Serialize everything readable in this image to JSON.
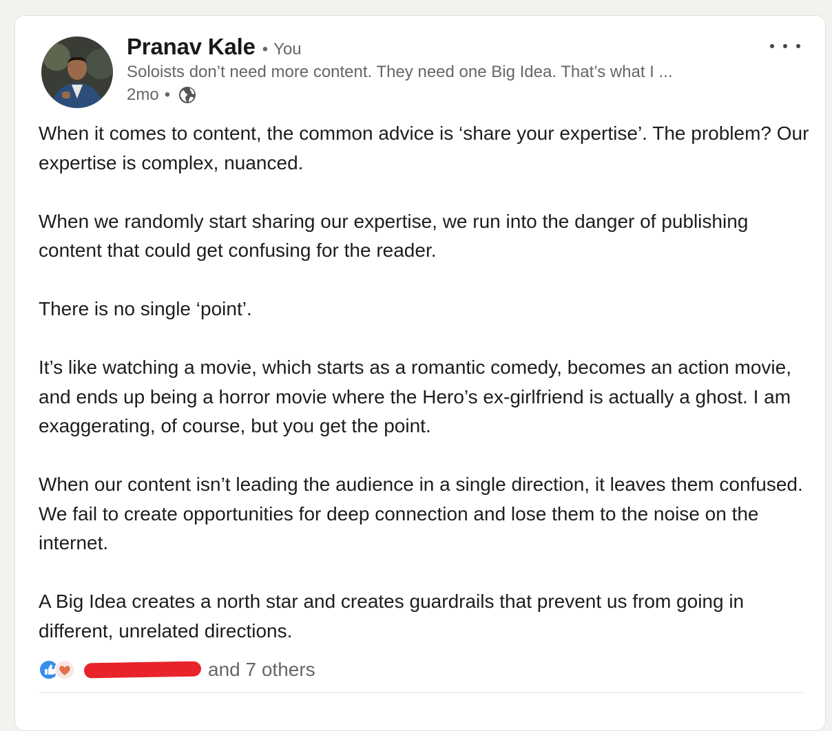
{
  "post": {
    "author": {
      "name": "Pranav Kale",
      "relation": "You",
      "headline": "Soloists don’t need more content. They need one Big Idea. That’s what I ...",
      "time": "2mo",
      "visibility_icon": "globe-icon"
    },
    "menu_icon": "more-horizontal-icon",
    "paragraphs": [
      "When it comes to content, the common advice is ‘share your expertise’. The problem? Our expertise is complex, nuanced.",
      "When we randomly start sharing our expertise, we run into the danger of publishing content that could get confusing for the reader.",
      "There is no single ‘point’.",
      "It’s like watching a movie, which starts as a romantic comedy, becomes an action movie, and ends up being a horror movie where the Hero’s ex-girlfriend is actually a ghost. I am exaggerating, of course, but you get the point.",
      "When our content isn’t leading the audience in a single direction, it leaves them confused. We fail to create opportunities for deep connection and lose them to the noise on the internet.",
      "A Big Idea creates a north star and creates guardrails that prevent us from going in different, unrelated directions."
    ],
    "reactions": {
      "icons": [
        "like-icon",
        "love-icon"
      ],
      "others_text": "and 7 others",
      "redaction_color": "#e8232b"
    }
  },
  "colors": {
    "background": "#f3f2ef",
    "card": "#ffffff",
    "secondary_text": "#666666",
    "like_blue": "#378fe9",
    "love_pink": "#df704d"
  }
}
